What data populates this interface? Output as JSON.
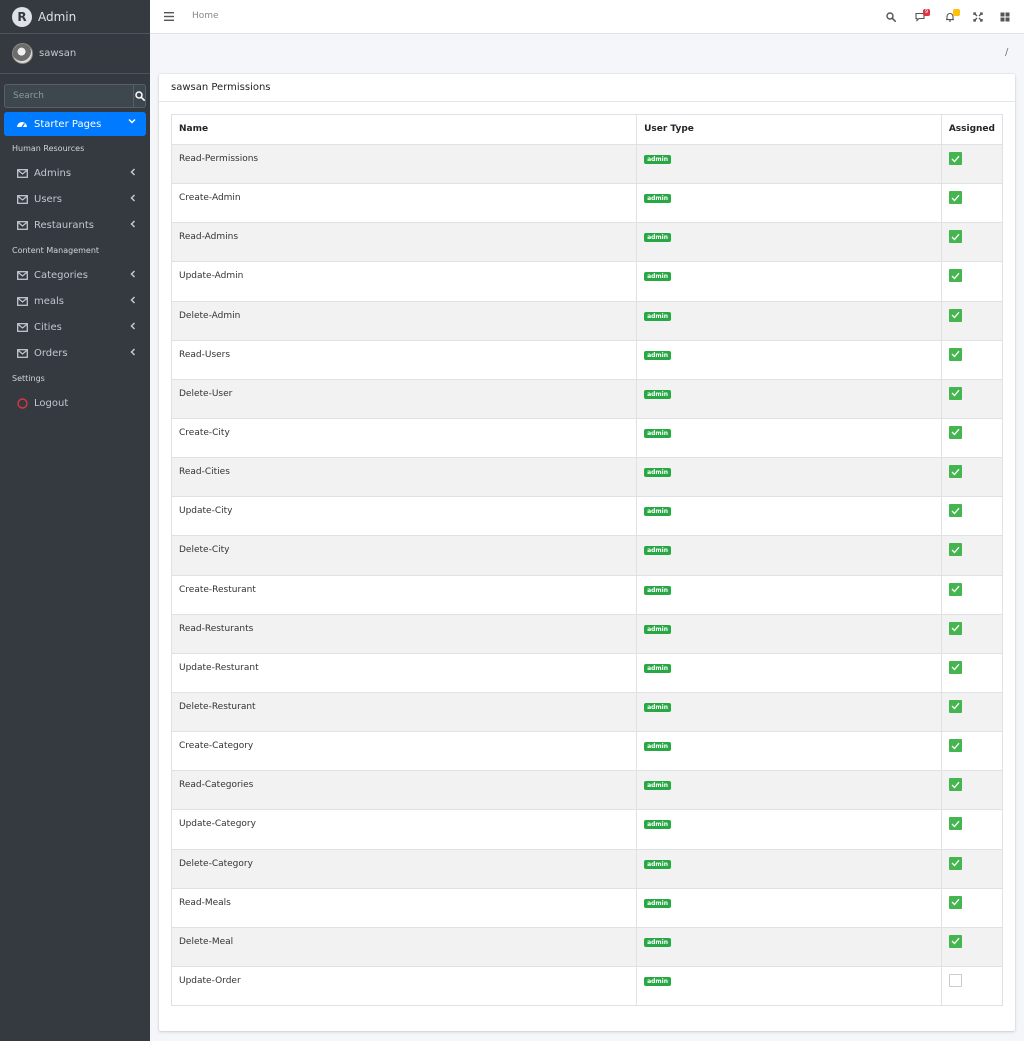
{
  "brand": {
    "name": "Admin",
    "logo_letter": "R"
  },
  "user": {
    "name": "sawsan"
  },
  "search": {
    "placeholder": "Search"
  },
  "nav": {
    "active": {
      "label": "Starter Pages"
    },
    "sections": [
      {
        "header": "Human Resources",
        "items": [
          {
            "label": "Admins"
          },
          {
            "label": "Users"
          },
          {
            "label": "Restaurants"
          }
        ]
      },
      {
        "header": "Content Management",
        "items": [
          {
            "label": "Categories"
          },
          {
            "label": "meals"
          },
          {
            "label": "Cities"
          },
          {
            "label": "Orders"
          }
        ]
      },
      {
        "header": "Settings",
        "items": [
          {
            "label": "Logout"
          }
        ]
      }
    ]
  },
  "topbar": {
    "home": "Home",
    "messages_count": "9",
    "accent_red": "#dc3545",
    "accent_yellow": "#ffc107"
  },
  "breadcrumb": {
    "separator": "/"
  },
  "card": {
    "title": "sawsan Permissions"
  },
  "table": {
    "headers": {
      "name": "Name",
      "user_type": "User Type",
      "assigned": "Assigned"
    },
    "rows": [
      {
        "name": "Read-Permissions",
        "type": "admin",
        "assigned": true
      },
      {
        "name": "Create-Admin",
        "type": "admin",
        "assigned": true
      },
      {
        "name": "Read-Admins",
        "type": "admin",
        "assigned": true
      },
      {
        "name": "Update-Admin",
        "type": "admin",
        "assigned": true
      },
      {
        "name": "Delete-Admin",
        "type": "admin",
        "assigned": true
      },
      {
        "name": "Read-Users",
        "type": "admin",
        "assigned": true
      },
      {
        "name": "Delete-User",
        "type": "admin",
        "assigned": true
      },
      {
        "name": "Create-City",
        "type": "admin",
        "assigned": true
      },
      {
        "name": "Read-Cities",
        "type": "admin",
        "assigned": true
      },
      {
        "name": "Update-City",
        "type": "admin",
        "assigned": true
      },
      {
        "name": "Delete-City",
        "type": "admin",
        "assigned": true
      },
      {
        "name": "Create-Resturant",
        "type": "admin",
        "assigned": true
      },
      {
        "name": "Read-Resturants",
        "type": "admin",
        "assigned": true
      },
      {
        "name": "Update-Resturant",
        "type": "admin",
        "assigned": true
      },
      {
        "name": "Delete-Resturant",
        "type": "admin",
        "assigned": true
      },
      {
        "name": "Create-Category",
        "type": "admin",
        "assigned": true
      },
      {
        "name": "Read-Categories",
        "type": "admin",
        "assigned": true
      },
      {
        "name": "Update-Category",
        "type": "admin",
        "assigned": true
      },
      {
        "name": "Delete-Category",
        "type": "admin",
        "assigned": true
      },
      {
        "name": "Read-Meals",
        "type": "admin",
        "assigned": true
      },
      {
        "name": "Delete-Meal",
        "type": "admin",
        "assigned": true
      },
      {
        "name": "Update-Order",
        "type": "admin",
        "assigned": false
      }
    ]
  }
}
